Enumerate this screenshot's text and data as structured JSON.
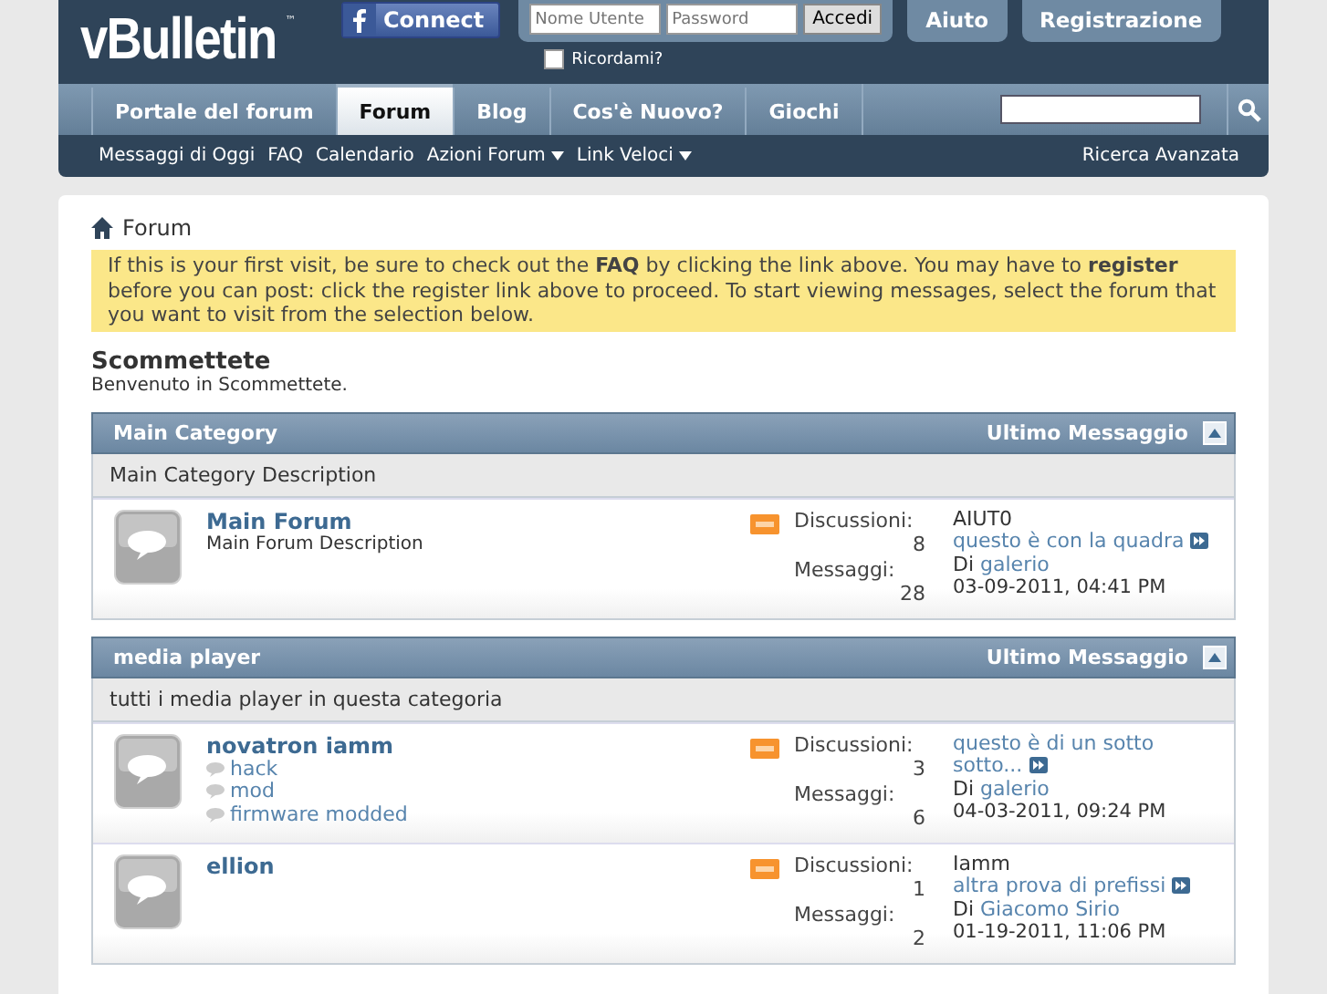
{
  "header": {
    "logo": "vBulletin",
    "logo_tm": "™",
    "connect_button": "Connect",
    "login": {
      "username_placeholder": "Nome Utente",
      "password_placeholder": "Password",
      "submit": "Accedi",
      "remember": {
        "label": "Ricordami?",
        "checked": false
      }
    },
    "buttons": [
      "Aiuto",
      "Registrazione"
    ]
  },
  "nav_tabs": [
    {
      "label": "Portale del forum",
      "selected": false
    },
    {
      "label": "Forum",
      "selected": true
    },
    {
      "label": "Blog",
      "selected": false
    },
    {
      "label": "Cos'è Nuovo?",
      "selected": false
    },
    {
      "label": "Giochi",
      "selected": false
    }
  ],
  "subnav": {
    "items": [
      {
        "label": "Messaggi di Oggi",
        "dropdown": false
      },
      {
        "label": "FAQ",
        "dropdown": false
      },
      {
        "label": "Calendario",
        "dropdown": false
      },
      {
        "label": "Azioni Forum",
        "dropdown": true
      },
      {
        "label": "Link Veloci",
        "dropdown": true
      }
    ],
    "advanced_search": "Ricerca Avanzata"
  },
  "breadcrumb": "Forum",
  "notice": "If this is your first visit, be sure to check out the **FAQ** by clicking the link above. You may have to **register** before you can post: click the register link above to proceed. To start viewing messages, select the forum that you want to visit from the selection below.",
  "forum_title": "Scommettete",
  "forum_welcome": "Benvenuto in Scommettete.",
  "categories": [
    {
      "title": "Main Category",
      "last_post_heading": "Ultimo Messaggio",
      "description": "Main Category Description",
      "forums": [
        {
          "name": "Main Forum",
          "description": "Main Forum Description",
          "discussions_label": "Discussioni:",
          "discussions": "8",
          "messages_label": "Messaggi:",
          "messages": "28",
          "last_post": {
            "prefix": "AIUT0",
            "title": "questo è con la quadra",
            "by": "Di",
            "author": "galerio",
            "date": "03-09-2011, 04:41 PM"
          }
        }
      ]
    },
    {
      "title": "media player",
      "last_post_heading": "Ultimo Messaggio",
      "description": "tutti i media player in questa categoria",
      "forums": [
        {
          "name": "novatron iamm",
          "subforums": [
            "hack",
            "mod",
            "firmware modded"
          ],
          "discussions_label": "Discussioni:",
          "discussions": "3",
          "messages_label": "Messaggi:",
          "messages": "6",
          "last_post": {
            "title": "questo è di un sotto sotto...",
            "by": "Di",
            "author": "galerio",
            "date": "04-03-2011, 09:24 PM"
          }
        },
        {
          "name": "ellion",
          "discussions_label": "Discussioni:",
          "discussions": "1",
          "messages_label": "Messaggi:",
          "messages": "2",
          "last_post": {
            "prefix": "Iamm",
            "title": "altra prova di prefissi",
            "by": "Di",
            "author": "Giacomo Sirio",
            "date": "01-19-2011, 11:06 PM"
          }
        }
      ]
    }
  ]
}
